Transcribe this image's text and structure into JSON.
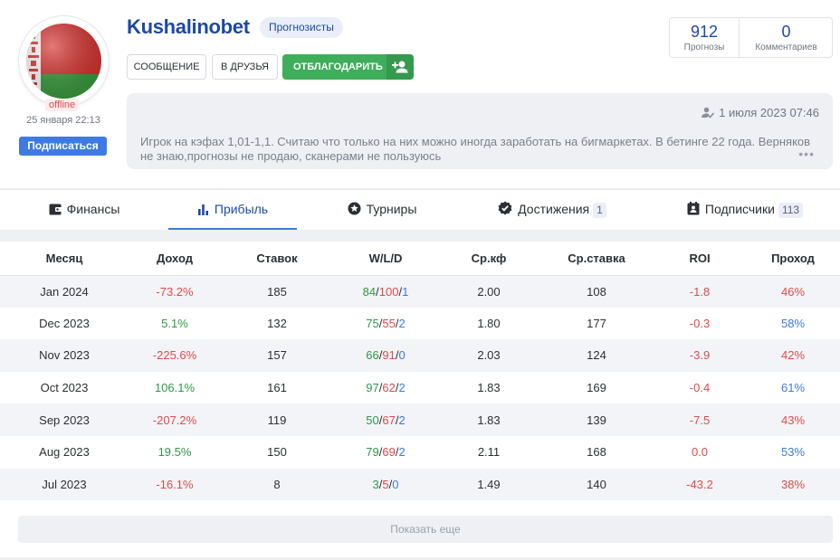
{
  "profile": {
    "username": "Kushalinobet",
    "role_badge": "Прогнозисты",
    "status": "offline",
    "join_date": "25 января 22:13",
    "subscribe_label": "Подписаться",
    "buttons": {
      "message": "СООБЩЕНИЕ",
      "add_friend": "В ДРУЗЬЯ",
      "thank": "ОТБЛАГОДАРИТЬ"
    },
    "stats": {
      "predictions_count": "912",
      "predictions_label": "Прогнозы",
      "comments_count": "0",
      "comments_label": "Комментариев"
    },
    "bio": {
      "date": "1 июля 2023 07:46",
      "text": "Игрок на кэфах 1,01-1,1. Считаю что только на них можно иногда заработать на бигмаркетах. В бетинге 22 года. Верняков не знаю,прогнозы не продаю, сканерами не пользуюсь",
      "more": "•••"
    },
    "flag_colors": {
      "red": "#d6322f",
      "green": "#3a9b3f",
      "white": "#ffffff"
    }
  },
  "tabs": [
    {
      "label": "Финансы",
      "icon": "wallet-icon"
    },
    {
      "label": "Прибыль",
      "icon": "bar-chart-icon",
      "active": true
    },
    {
      "label": "Турниры",
      "icon": "star-icon"
    },
    {
      "label": "Достижения",
      "icon": "badge-check-icon",
      "count": "1"
    },
    {
      "label": "Подписчики",
      "icon": "contact-icon",
      "count": "113"
    }
  ],
  "table": {
    "headers": [
      "Месяц",
      "Доход",
      "Ставок",
      "W/L/D",
      "Ср.кф",
      "Ср.ставка",
      "ROI",
      "Проход"
    ],
    "rows": [
      {
        "month": "Jan 2024",
        "income": "-73.2%",
        "bets": "185",
        "w": "84",
        "l": "100",
        "d": "1",
        "avg_odds": "2.00",
        "avg_stake": "108",
        "roi": "-1.8",
        "pass": "46%"
      },
      {
        "month": "Dec 2023",
        "income": "5.1%",
        "bets": "132",
        "w": "75",
        "l": "55",
        "d": "2",
        "avg_odds": "1.80",
        "avg_stake": "177",
        "roi": "-0.3",
        "pass": "58%"
      },
      {
        "month": "Nov 2023",
        "income": "-225.6%",
        "bets": "157",
        "w": "66",
        "l": "91",
        "d": "0",
        "avg_odds": "2.03",
        "avg_stake": "124",
        "roi": "-3.9",
        "pass": "42%"
      },
      {
        "month": "Oct 2023",
        "income": "106.1%",
        "bets": "161",
        "w": "97",
        "l": "62",
        "d": "2",
        "avg_odds": "1.83",
        "avg_stake": "169",
        "roi": "-0.4",
        "pass": "61%"
      },
      {
        "month": "Sep 2023",
        "income": "-207.2%",
        "bets": "119",
        "w": "50",
        "l": "67",
        "d": "2",
        "avg_odds": "1.83",
        "avg_stake": "139",
        "roi": "-7.5",
        "pass": "43%"
      },
      {
        "month": "Aug 2023",
        "income": "19.5%",
        "bets": "150",
        "w": "79",
        "l": "69",
        "d": "2",
        "avg_odds": "2.11",
        "avg_stake": "168",
        "roi": "0.0",
        "pass": "53%"
      },
      {
        "month": "Jul 2023",
        "income": "-16.1%",
        "bets": "8",
        "w": "3",
        "l": "5",
        "d": "0",
        "avg_odds": "1.49",
        "avg_stake": "140",
        "roi": "-43.2",
        "pass": "38%"
      }
    ],
    "show_more_label": "Показать еще"
  },
  "colors": {
    "accent": "#1c4aa5",
    "button_blue": "#3d7be3",
    "positive": "#2e9a45",
    "negative": "#e04a4a",
    "neutral_blue": "#3d7be3"
  }
}
